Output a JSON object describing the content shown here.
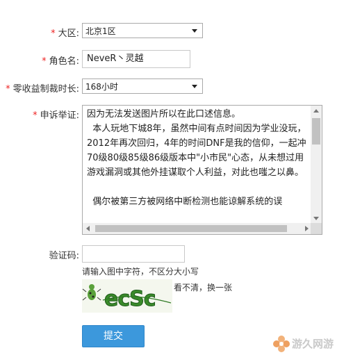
{
  "form": {
    "required_mark": "*",
    "region": {
      "label": "大区:",
      "value": "北京1区"
    },
    "role_name": {
      "label": "角色名:",
      "value": "NeveR丶灵越"
    },
    "ban_duration": {
      "label": "零收益制裁时长:",
      "value": "168小时"
    },
    "appeal": {
      "label": "申诉举证:",
      "text": "因为无法发送图片所以在此口述信息。\n  本人玩地下城8年，虽然中间有点时间因为学业没玩，2012年再次回归，4年的时间DNF是我的信仰，一起冲70级80级85级86级版本中\"小市民\"心态，从未想过用游戏漏洞或其他外挂谋取个人利益，对此也嗤之以鼻。\n\n  偶尔被第三方被网络中断检测也能谅解系统的误"
    },
    "captcha": {
      "label": "验证码:",
      "value": "",
      "hint": "请输入图中字符，不区分大小写",
      "image_text": "ecSc",
      "refresh_label": "看不清，换一张"
    },
    "submit_label": "提交"
  },
  "watermark": {
    "text": "游久网游"
  },
  "colors": {
    "required": "#ee2222",
    "submit_bg": "#3c98dc",
    "submit_text": "#ffffff"
  }
}
